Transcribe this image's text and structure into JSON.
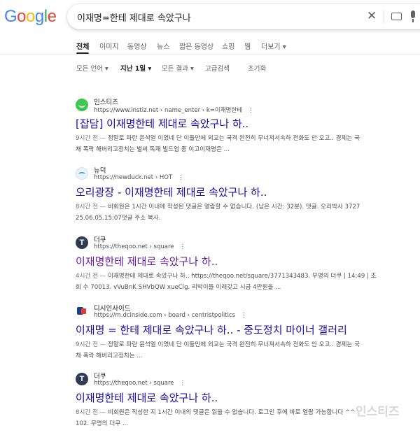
{
  "header": {
    "logo": {
      "letters": [
        "G",
        "o",
        "o",
        "g",
        "l",
        "e"
      ],
      "colors": [
        "#4285F4",
        "#EA4335",
        "#FBBC05",
        "#4285F4",
        "#34A853",
        "#EA4335"
      ]
    },
    "search": {
      "query": "이재명=한테 제대로 속았구나"
    },
    "icons": [
      "close-icon",
      "keyboard-icon",
      "mic-icon"
    ]
  },
  "tabs": [
    {
      "label": "전체",
      "active": true
    },
    {
      "label": "이미지"
    },
    {
      "label": "동영상"
    },
    {
      "label": "뉴스"
    },
    {
      "label": "짧은 동영상"
    },
    {
      "label": "쇼핑"
    },
    {
      "label": "웹"
    },
    {
      "label": "더보기 ▾"
    }
  ],
  "filters": [
    {
      "label": "모든 언어 ▾"
    },
    {
      "label": "지난 1일 ▾",
      "bold": true
    },
    {
      "label": "모든 결과 ▾"
    },
    {
      "label": "고급검색"
    },
    {
      "label": "초기화"
    }
  ],
  "results": [
    {
      "site": "인스티즈",
      "url": "https://www.instiz.net › name_enter › k=이재명한테",
      "title": "[잡담] 이재명한테 제대로 속았구나 하..",
      "meta": "9시간 전 — ",
      "snippet1": "정말로 파란 윤석열 이였네 단 이들만에 외교는 국격 완전히 무너져서속하 전화도 안 오고.. 경제는 국",
      "snippet2": "채 폭락 해버리고정치는 벌써 독재 빌드업 중 이고이재명은 ..."
    },
    {
      "site": "뉴덕",
      "url": "https://newduck.net › HOT",
      "title": "오리광장 - 이재명한테 제대로 속았구나 하..",
      "meta": "8시간 전 — ",
      "snippet1": "비회원은 1시간 이내에 작성된 댓글은 열람할 수 없습니다. (남은 시간: 32분). 댓글. 오리박사 3727",
      "snippet2": "25.06.05.15:07댓글 주소 복사."
    },
    {
      "site": "더쿠",
      "url": "https://theqoo.net › square",
      "title": "이재명한테 제대로 속았구나 하..",
      "meta": "4시간 전 — ",
      "snippet1": "이재명한테 제대로 속았구나 하.. https://theqoo.net/square/3771343483. 무명의 더쿠 | 14:49 | 조",
      "snippet2": "회 수 70013. vVuBnK SHVbQW xueClg. 리박이들 이래갖고 시급 4만원을 ..."
    },
    {
      "site": "디시인사이드",
      "url": "https://m.dcinside.com › board › centristpolitics",
      "title": "이재명 = 한테 제대로 속았구나 하.. - 중도정치 마이너 갤러리",
      "meta": "9시간 전 — ",
      "snippet1": "정말로 파란 윤석열 이였네 단 이들만에 외교는 국격 완전히 무너져서속하 전화도 안 오고.. 경제는 국",
      "snippet2": "채 폭락 해버리고정치는 ..."
    },
    {
      "site": "더쿠",
      "url": "https://theqoo.net › square",
      "title": "이재명한테 제대로 속았구나 하..",
      "meta": "8시간 전 — ",
      "snippet1": "비회원은 작성한 지 1시간 이내의 댓글은 읽을 수 없습니다. 로그인 후에 바로 열람 가능합니다 ^^",
      "snippet2": "102. 무명의 더쿠 ..."
    }
  ],
  "watermark": "인스티즈"
}
